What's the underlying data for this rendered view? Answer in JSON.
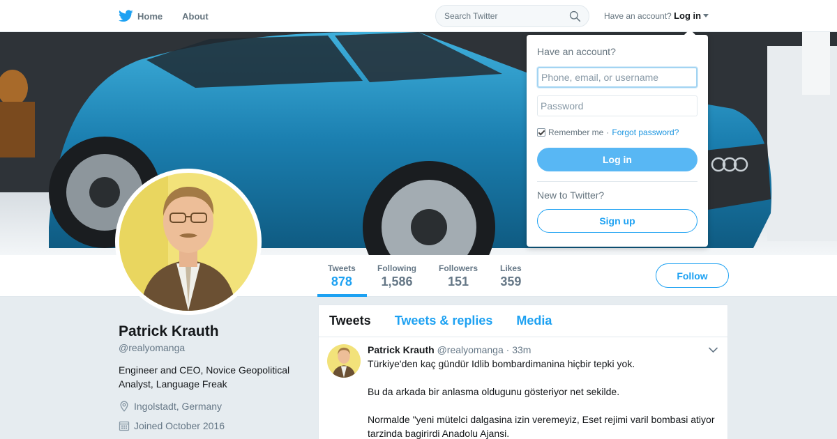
{
  "nav": {
    "home_label": "Home",
    "about_label": "About",
    "search_placeholder": "Search Twitter",
    "account_prompt": "Have an account?",
    "login_label": "Log in"
  },
  "stats": [
    {
      "label": "Tweets",
      "value": "878"
    },
    {
      "label": "Following",
      "value": "1,586"
    },
    {
      "label": "Followers",
      "value": "151"
    },
    {
      "label": "Likes",
      "value": "359"
    }
  ],
  "follow_label": "Follow",
  "profile": {
    "name": "Patrick Krauth",
    "handle": "@realyomanga",
    "bio": "Engineer and CEO, Novice Geopolitical Analyst, Language Freak",
    "location": "Ingolstadt, Germany",
    "joined": "Joined October 2016"
  },
  "timeline": {
    "tabs": [
      "Tweets",
      "Tweets & replies",
      "Media"
    ],
    "tweet": {
      "name": "Patrick Krauth",
      "handle": "@realyomanga",
      "time": "33m",
      "paragraphs": [
        "Türkiye'den kaç gündür Idlib bombardimanina hiçbir tepki yok.",
        "Bu da arkada bir anlasma oldugunu gösteriyor net sekilde.",
        "Normalde \"yeni mütelci dalgasina izin veremeyiz, Eset rejimi varil bombasi atiyor tarzinda bagirirdi Anadolu Ajansi."
      ]
    }
  },
  "login_dropdown": {
    "title": "Have an account?",
    "username_placeholder": "Phone, email, or username",
    "password_placeholder": "Password",
    "remember_label": "Remember me",
    "separator": "·",
    "forgot_label": "Forgot password?",
    "login_button": "Log in",
    "new_prompt": "New to Twitter?",
    "signup_button": "Sign up"
  },
  "colors": {
    "accent": "#1da1f2",
    "login_button": "#58b7f4",
    "page_background": "#e6ecf0"
  },
  "icons": [
    "twitter-bird-icon",
    "home-icon",
    "search-icon",
    "caret-down-icon",
    "location-pin-icon",
    "calendar-icon",
    "chevron-down-icon"
  ]
}
